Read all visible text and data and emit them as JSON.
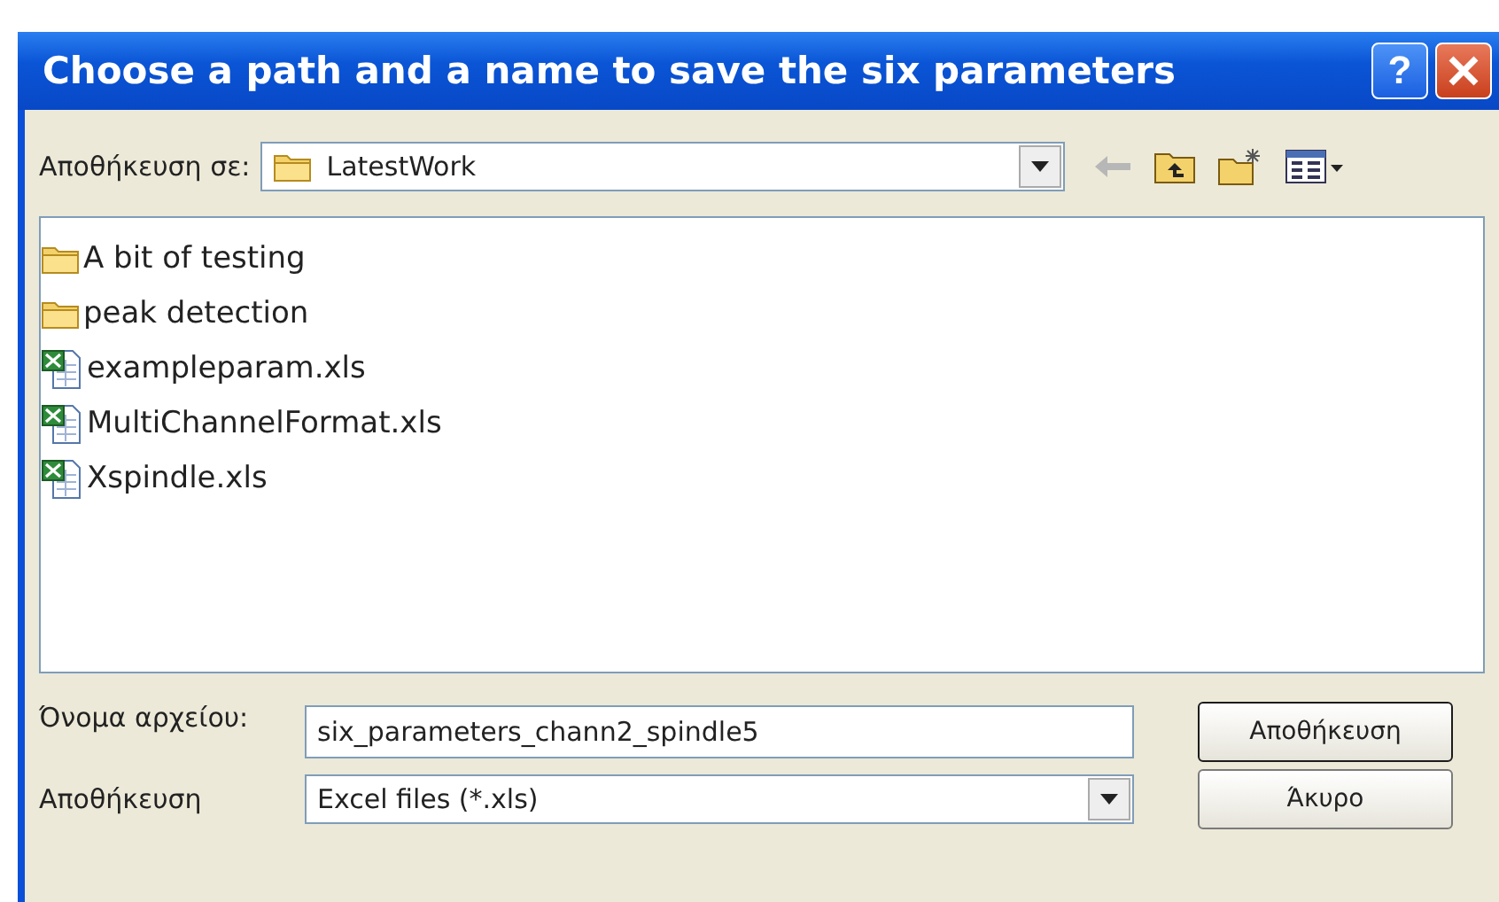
{
  "window": {
    "title": "Choose a path and a name to save the six parameters",
    "help_button": "?"
  },
  "location": {
    "label": "Αποθήκευση σε:",
    "value": "LatestWork"
  },
  "files": [
    {
      "name": "A bit of testing",
      "kind": "folder"
    },
    {
      "name": "peak detection",
      "kind": "folder"
    },
    {
      "name": "exampleparam.xls",
      "kind": "excel"
    },
    {
      "name": "MultiChannelFormat.xls",
      "kind": "excel"
    },
    {
      "name": "Xspindle.xls",
      "kind": "excel"
    }
  ],
  "file_name": {
    "label": "Όνομα αρχείου:",
    "value": "six_parameters_chann2_spindle5"
  },
  "file_type": {
    "label": "Αποθήκευση",
    "value": "Excel files (*.xls)"
  },
  "buttons": [
    "Αποθήκευση",
    "Άκυρο"
  ]
}
